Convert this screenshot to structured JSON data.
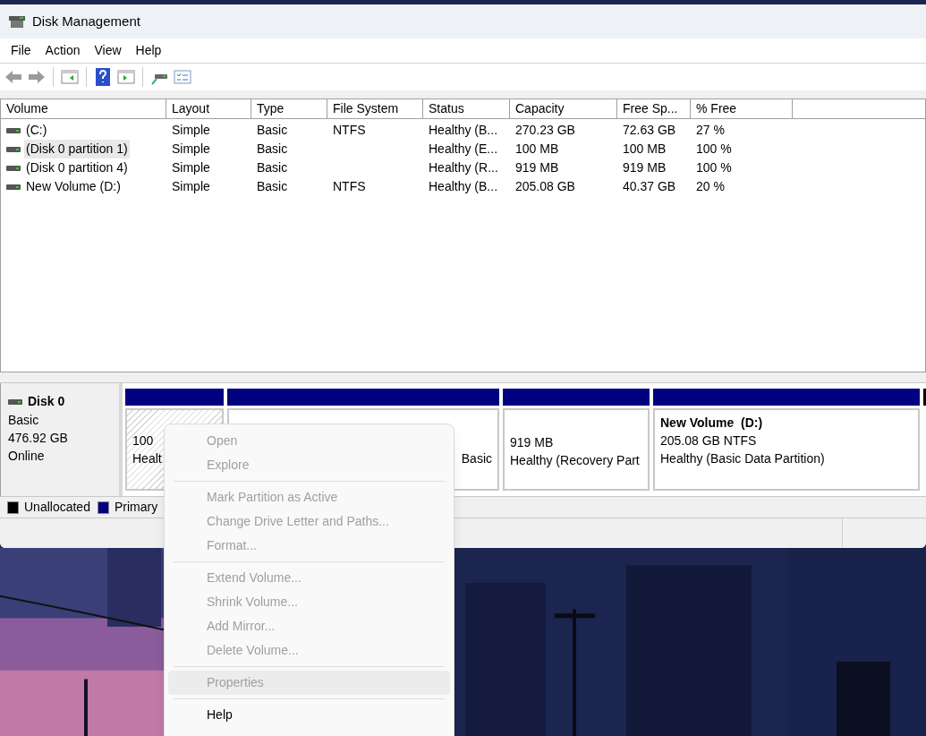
{
  "window": {
    "title": "Disk Management"
  },
  "menu_bar": [
    "File",
    "Action",
    "View",
    "Help"
  ],
  "volume_table": {
    "columns": [
      "Volume",
      "Layout",
      "Type",
      "File System",
      "Status",
      "Capacity",
      "Free Sp...",
      "% Free"
    ],
    "rows": [
      {
        "selected": false,
        "cells": [
          "(C:)",
          "Simple",
          "Basic",
          "NTFS",
          "Healthy (B...",
          "270.23 GB",
          "72.63 GB",
          "27 %"
        ]
      },
      {
        "selected": true,
        "cells": [
          "(Disk 0 partition 1)",
          "Simple",
          "Basic",
          "",
          "Healthy (E...",
          "100 MB",
          "100 MB",
          "100 %"
        ]
      },
      {
        "selected": false,
        "cells": [
          "(Disk 0 partition 4)",
          "Simple",
          "Basic",
          "",
          "Healthy (R...",
          "919 MB",
          "919 MB",
          "100 %"
        ]
      },
      {
        "selected": false,
        "cells": [
          "New Volume (D:)",
          "Simple",
          "Basic",
          "NTFS",
          "Healthy (B...",
          "205.08 GB",
          "40.37 GB",
          "20 %"
        ]
      }
    ]
  },
  "disk": {
    "name": "Disk 0",
    "lines": [
      "Basic",
      "476.92 GB",
      "Online"
    ],
    "partitions": [
      {
        "kind": "hatched",
        "color": "#000080",
        "lines": [
          "100",
          "Healt"
        ]
      },
      {
        "kind": "covered",
        "color": "#000080",
        "lines": [
          "Basic"
        ]
      },
      {
        "kind": "plain",
        "color": "#000080",
        "lines": [
          "919 MB",
          "Healthy (Recovery Part"
        ]
      },
      {
        "kind": "plain",
        "color": "#000080",
        "title": "New Volume  (D:)",
        "lines": [
          "205.08 GB NTFS",
          "Healthy (Basic Data Partition)"
        ]
      },
      {
        "kind": "sliver",
        "color": "#000000"
      }
    ]
  },
  "legend": [
    {
      "label": "Unallocated",
      "color": "#000000"
    },
    {
      "label": "Primary",
      "color": "#000080"
    }
  ],
  "context_menu": [
    {
      "kind": "item",
      "label": "Open",
      "disabled": true,
      "selected": false
    },
    {
      "kind": "item",
      "label": "Explore",
      "disabled": true,
      "selected": false
    },
    {
      "kind": "separator"
    },
    {
      "kind": "item",
      "label": "Mark Partition as Active",
      "disabled": true,
      "selected": false
    },
    {
      "kind": "item",
      "label": "Change Drive Letter and Paths...",
      "disabled": true,
      "selected": false
    },
    {
      "kind": "item",
      "label": "Format...",
      "disabled": true,
      "selected": false
    },
    {
      "kind": "separator"
    },
    {
      "kind": "item",
      "label": "Extend Volume...",
      "disabled": true,
      "selected": false
    },
    {
      "kind": "item",
      "label": "Shrink Volume...",
      "disabled": true,
      "selected": false
    },
    {
      "kind": "item",
      "label": "Add Mirror...",
      "disabled": true,
      "selected": false
    },
    {
      "kind": "item",
      "label": "Delete Volume...",
      "disabled": true,
      "selected": false
    },
    {
      "kind": "separator"
    },
    {
      "kind": "item",
      "label": "Properties",
      "disabled": true,
      "selected": true
    },
    {
      "kind": "separator"
    },
    {
      "kind": "item",
      "label": "Help",
      "disabled": false,
      "selected": false
    }
  ]
}
